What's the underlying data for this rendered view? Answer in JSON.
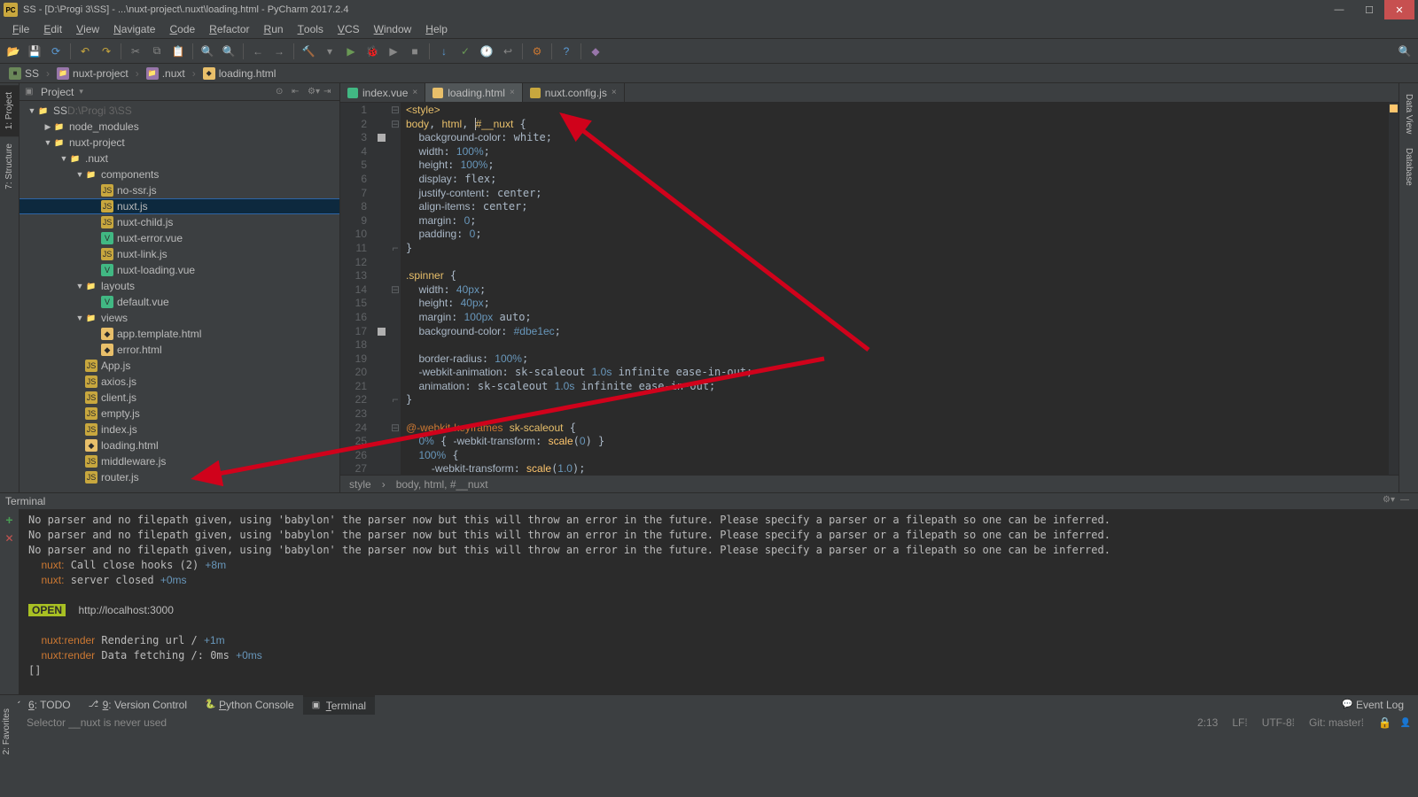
{
  "window": {
    "title": "SS - [D:\\Progi 3\\SS] - ...\\nuxt-project\\.nuxt\\loading.html - PyCharm 2017.2.4"
  },
  "menus": [
    "File",
    "Edit",
    "View",
    "Navigate",
    "Code",
    "Refactor",
    "Run",
    "Tools",
    "VCS",
    "Window",
    "Help"
  ],
  "breadcrumbs": [
    {
      "icon": "ss",
      "label": "SS"
    },
    {
      "icon": "folder",
      "label": "nuxt-project"
    },
    {
      "icon": "folder",
      "label": ".nuxt"
    },
    {
      "icon": "html",
      "label": "loading.html"
    }
  ],
  "project_panel": {
    "title": "Project",
    "tree": [
      {
        "depth": 0,
        "arrow": "▼",
        "icon": "folder",
        "label": "SS",
        "hint": "D:\\Progi 3\\SS"
      },
      {
        "depth": 1,
        "arrow": "▶",
        "icon": "folder",
        "label": "node_modules"
      },
      {
        "depth": 1,
        "arrow": "▼",
        "icon": "folder",
        "label": "nuxt-project"
      },
      {
        "depth": 2,
        "arrow": "▼",
        "icon": "folder",
        "label": ".nuxt"
      },
      {
        "depth": 3,
        "arrow": "▼",
        "icon": "folder",
        "label": "components"
      },
      {
        "depth": 4,
        "arrow": "",
        "icon": "js",
        "label": "no-ssr.js"
      },
      {
        "depth": 4,
        "arrow": "",
        "icon": "js",
        "label": "nuxt.js",
        "selected": true
      },
      {
        "depth": 4,
        "arrow": "",
        "icon": "js",
        "label": "nuxt-child.js"
      },
      {
        "depth": 4,
        "arrow": "",
        "icon": "vue",
        "label": "nuxt-error.vue"
      },
      {
        "depth": 4,
        "arrow": "",
        "icon": "js",
        "label": "nuxt-link.js"
      },
      {
        "depth": 4,
        "arrow": "",
        "icon": "vue",
        "label": "nuxt-loading.vue"
      },
      {
        "depth": 3,
        "arrow": "▼",
        "icon": "folder",
        "label": "layouts"
      },
      {
        "depth": 4,
        "arrow": "",
        "icon": "vue",
        "label": "default.vue"
      },
      {
        "depth": 3,
        "arrow": "▼",
        "icon": "folder",
        "label": "views"
      },
      {
        "depth": 4,
        "arrow": "",
        "icon": "html",
        "label": "app.template.html"
      },
      {
        "depth": 4,
        "arrow": "",
        "icon": "html",
        "label": "error.html"
      },
      {
        "depth": 3,
        "arrow": "",
        "icon": "js",
        "label": "App.js"
      },
      {
        "depth": 3,
        "arrow": "",
        "icon": "js",
        "label": "axios.js"
      },
      {
        "depth": 3,
        "arrow": "",
        "icon": "js",
        "label": "client.js"
      },
      {
        "depth": 3,
        "arrow": "",
        "icon": "js",
        "label": "empty.js"
      },
      {
        "depth": 3,
        "arrow": "",
        "icon": "js",
        "label": "index.js"
      },
      {
        "depth": 3,
        "arrow": "",
        "icon": "html",
        "label": "loading.html"
      },
      {
        "depth": 3,
        "arrow": "",
        "icon": "js",
        "label": "middleware.js"
      },
      {
        "depth": 3,
        "arrow": "",
        "icon": "js",
        "label": "router.js"
      }
    ]
  },
  "tabs": [
    {
      "label": "index.vue",
      "icon": "vue",
      "active": false
    },
    {
      "label": "loading.html",
      "icon": "html",
      "active": true
    },
    {
      "label": "nuxt.config.js",
      "icon": "js",
      "active": false
    }
  ],
  "code_breadcrumb": [
    "style",
    "body, html, #__nuxt"
  ],
  "terminal": {
    "title": "Terminal",
    "lines": [
      "No parser and no filepath given, using 'babylon' the parser now but this will throw an error in the future. Please specify a parser or a filepath so one can be inferred.",
      "No parser and no filepath given, using 'babylon' the parser now but this will throw an error in the future. Please specify a parser or a filepath so one can be inferred.",
      "No parser and no filepath given, using 'babylon' the parser now but this will throw an error in the future. Please specify a parser or a filepath so one can be inferred."
    ],
    "nuxt_lines": [
      {
        "prefix": "nuxt:",
        "text": " Call close hooks (2) ",
        "time": "+8m"
      },
      {
        "prefix": "nuxt:",
        "text": " server closed ",
        "time": "+0ms"
      }
    ],
    "open_label": "OPEN",
    "open_url": "http://localhost:3000",
    "render_lines": [
      {
        "prefix": "nuxt:render",
        "text": " Rendering url / ",
        "time": "+1m"
      },
      {
        "prefix": "nuxt:render",
        "text": " Data fetching /: 0ms ",
        "time": "+0ms"
      }
    ],
    "cursor": "[]"
  },
  "bottom_bar": [
    {
      "icon": "✓",
      "label": "6: TODO",
      "underline": "6"
    },
    {
      "icon": "⎇",
      "label": "9: Version Control",
      "underline": "9"
    },
    {
      "icon": "🐍",
      "label": "Python Console",
      "underline": "P"
    },
    {
      "icon": "▣",
      "label": "Terminal",
      "underline": "T",
      "active": true
    }
  ],
  "event_log": "Event Log",
  "status": {
    "hint": "Selector __nuxt is never used",
    "pos": "2:13",
    "sep": "LF⁞",
    "enc": "UTF-8⁞",
    "git": "Git: master⁞"
  }
}
